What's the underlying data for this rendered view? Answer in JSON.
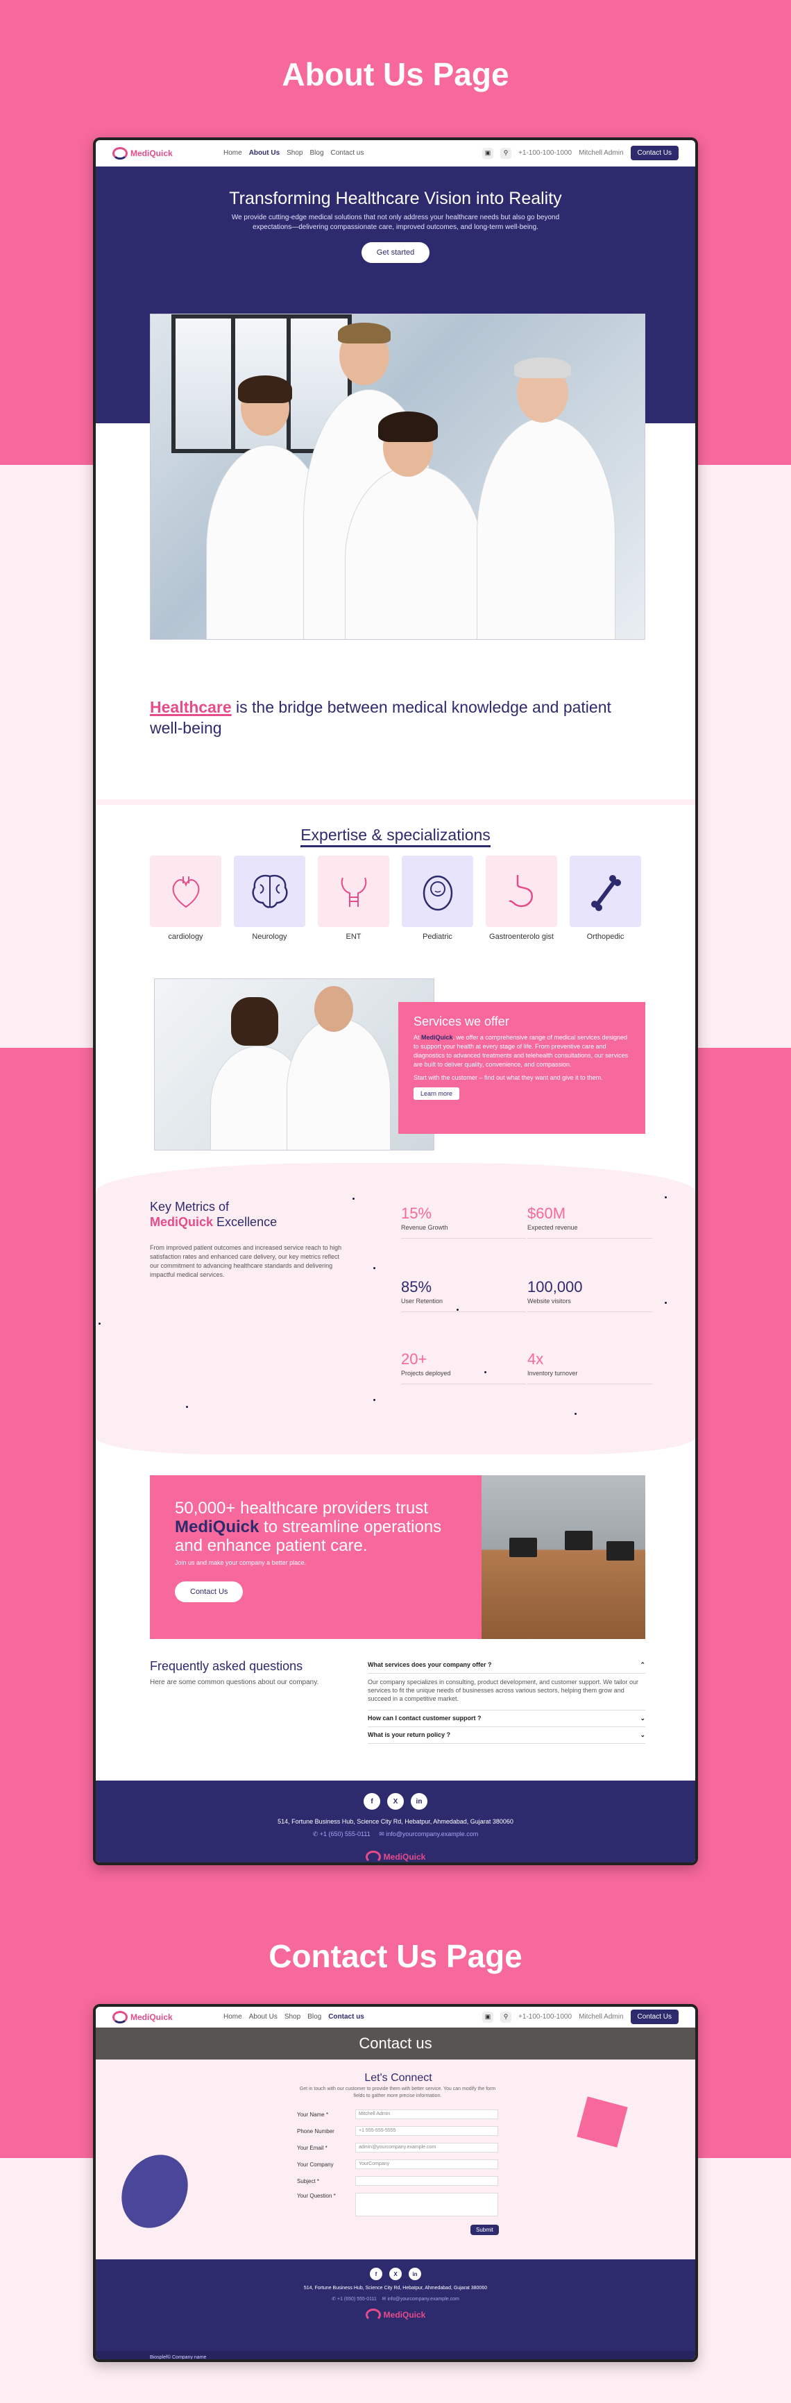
{
  "sections": {
    "about_title": "About Us Page",
    "contact_title": "Contact Us Page"
  },
  "nav": {
    "brand": "MediQuick",
    "links": [
      "Home",
      "About Us",
      "Shop",
      "Blog",
      "Contact us"
    ],
    "phone": "+1-100-100-1000",
    "account": "Mitchell Admin",
    "cta": "Contact Us"
  },
  "hero": {
    "title": "Transforming Healthcare Vision into Reality",
    "text": "We provide cutting-edge medical solutions that not only address your healthcare needs but also go beyond expectations—delivering compassionate care, improved outcomes, and long-term well-being.",
    "button": "Get started"
  },
  "tagline": {
    "highlight": "Healthcare",
    "rest": "is the bridge between medical knowledge and patient well-being"
  },
  "specializations": {
    "title": "Expertise & specializations",
    "items": [
      {
        "label": "cardiology",
        "icon": "heart-icon",
        "bg": "#fde8ef"
      },
      {
        "label": "Neurology",
        "icon": "brain-icon",
        "bg": "#e7e4fb"
      },
      {
        "label": "ENT",
        "icon": "throat-icon",
        "bg": "#fde8ef"
      },
      {
        "label": "Pediatric",
        "icon": "baby-icon",
        "bg": "#e7e4fb"
      },
      {
        "label": "Gastroenterolo gist",
        "icon": "stomach-icon",
        "bg": "#fde8ef"
      },
      {
        "label": "Orthopedic",
        "icon": "bone-icon",
        "bg": "#e7e4fb"
      }
    ]
  },
  "services": {
    "title": "Services we offer",
    "text_pre": "At",
    "text_brand": "MediQuick",
    "text": ", we offer a comprehensive range of medical services designed to support your health at every stage of life. From preventive care and diagnostics to advanced treatments and telehealth consultations, our services are built to deliver quality, convenience, and compassion.",
    "text2": "Start with the customer – find out what they want and give it to them.",
    "button": "Learn more"
  },
  "metrics": {
    "title_pre": "Key Metrics of",
    "title_brand": "MediQuick",
    "title_post": "Excellence",
    "text": "From improved patient outcomes and increased service reach to high satisfaction rates and enhanced care delivery, our key metrics reflect our commitment to advancing healthcare standards and delivering impactful medical services.",
    "items": [
      {
        "value": "15%",
        "label": "Revenue Growth"
      },
      {
        "value": "$60M",
        "label": "Expected revenue"
      },
      {
        "value": "85%",
        "label": "User Retention"
      },
      {
        "value": "100,000",
        "label": "Website visitors"
      },
      {
        "value": "20+",
        "label": "Projects deployed"
      },
      {
        "value": "4x",
        "label": "Inventory turnover"
      }
    ]
  },
  "trust": {
    "line1": "50,000+ healthcare providers trust",
    "brand": "MediQuick",
    "line2": "to streamline operations and enhance patient care.",
    "sub": "Join us and make your company a better place.",
    "button": "Contact Us"
  },
  "faq": {
    "title": "Frequently asked questions",
    "subtitle": "Here are some common questions about our company.",
    "items": [
      {
        "q": "What services does your company offer ?",
        "a": "Our company specializes in consulting, product development, and customer support. We tailor our services to fit the unique needs of businesses across various sectors, helping them grow and succeed in a competitive market."
      },
      {
        "q": "How can I contact customer support ?"
      },
      {
        "q": "What is your return policy ?"
      }
    ]
  },
  "footer": {
    "socials": [
      "f",
      "X",
      "in"
    ],
    "address": "514, Fortune Business Hub, Science City Rd, Hebatpur, Ahmedabad, Gujarat 380060",
    "phone": "+1 (650) 555-0111",
    "email": "info@yourcompany.example.com",
    "copyright": "Biosplef© Company name"
  },
  "contact": {
    "banner": "Contact us",
    "title": "Let's Connect",
    "text": "Get in touch with our customer to provide them with better service. You can modify the form fields to gather more precise information.",
    "fields": [
      {
        "label": "Your Name *",
        "value": "Mitchell Admin"
      },
      {
        "label": "Phone Number",
        "value": "+1 555-555-5555"
      },
      {
        "label": "Your Email *",
        "value": "admin@yourcompany.example.com"
      },
      {
        "label": "Your Company",
        "value": "YourCompany"
      },
      {
        "label": "Subject *",
        "value": ""
      },
      {
        "label": "Your Question *",
        "value": ""
      }
    ],
    "submit": "Submit"
  }
}
